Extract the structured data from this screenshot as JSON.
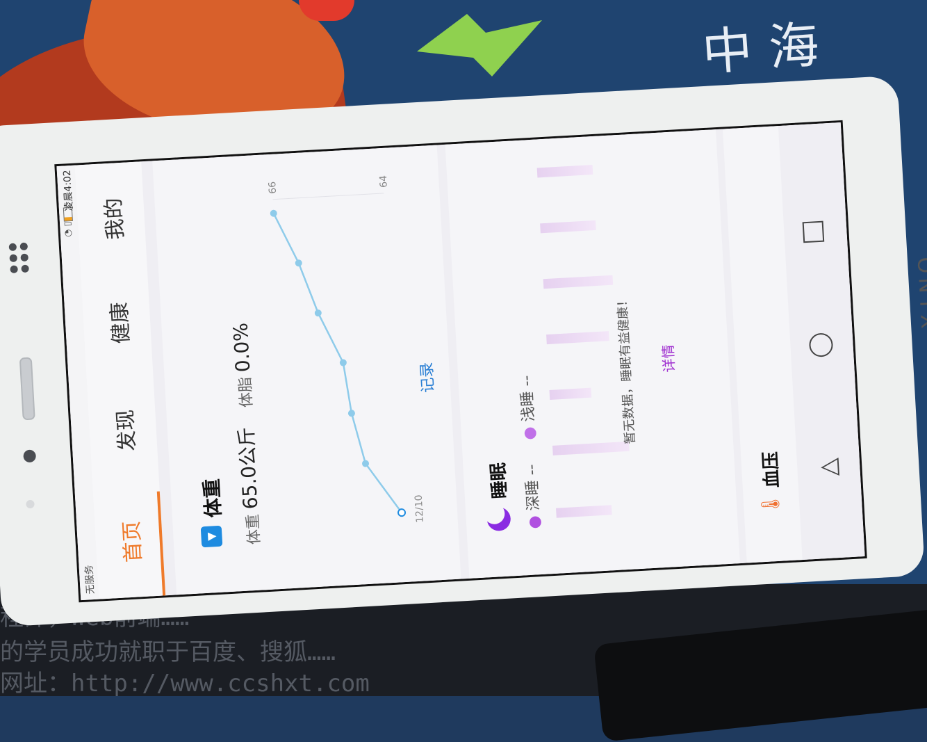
{
  "status_bar": {
    "carrier": "无服务",
    "time": "凌晨4:02"
  },
  "tabs": [
    {
      "label": "首页",
      "active": true
    },
    {
      "label": "发现",
      "active": false
    },
    {
      "label": "健康",
      "active": false
    },
    {
      "label": "我的",
      "active": false
    }
  ],
  "weight": {
    "title": "体重",
    "weight_label": "体重",
    "weight_value": "65.0公斤",
    "fat_label": "体脂",
    "fat_value": "0.0%",
    "record_label": "记录",
    "icon": "scale-icon",
    "accent": "#1e8be0"
  },
  "chart_data": {
    "type": "line",
    "x": [
      "12/10",
      "",
      "",
      "",
      "",
      "",
      ""
    ],
    "values": [
      64,
      64.6,
      64.8,
      64.9,
      65.3,
      65.6,
      66
    ],
    "y_ticks": [
      64,
      66
    ],
    "x_ticks": [
      "12/10"
    ],
    "ylim": [
      64,
      66
    ],
    "color": "#8ecbea"
  },
  "sleep": {
    "title": "睡眠",
    "deep_label": "深睡",
    "deep_value": "--",
    "light_label": "浅睡",
    "light_value": "--",
    "no_data": "暂无数据，睡眠有益健康！",
    "detail_label": "详情",
    "icon": "moon-icon",
    "accent": "#8a2be2"
  },
  "blood_pressure": {
    "title": "血压",
    "icon": "thermometer-icon"
  },
  "system_nav": {
    "back": "back-icon",
    "home": "home-icon",
    "recents": "recents-icon"
  }
}
